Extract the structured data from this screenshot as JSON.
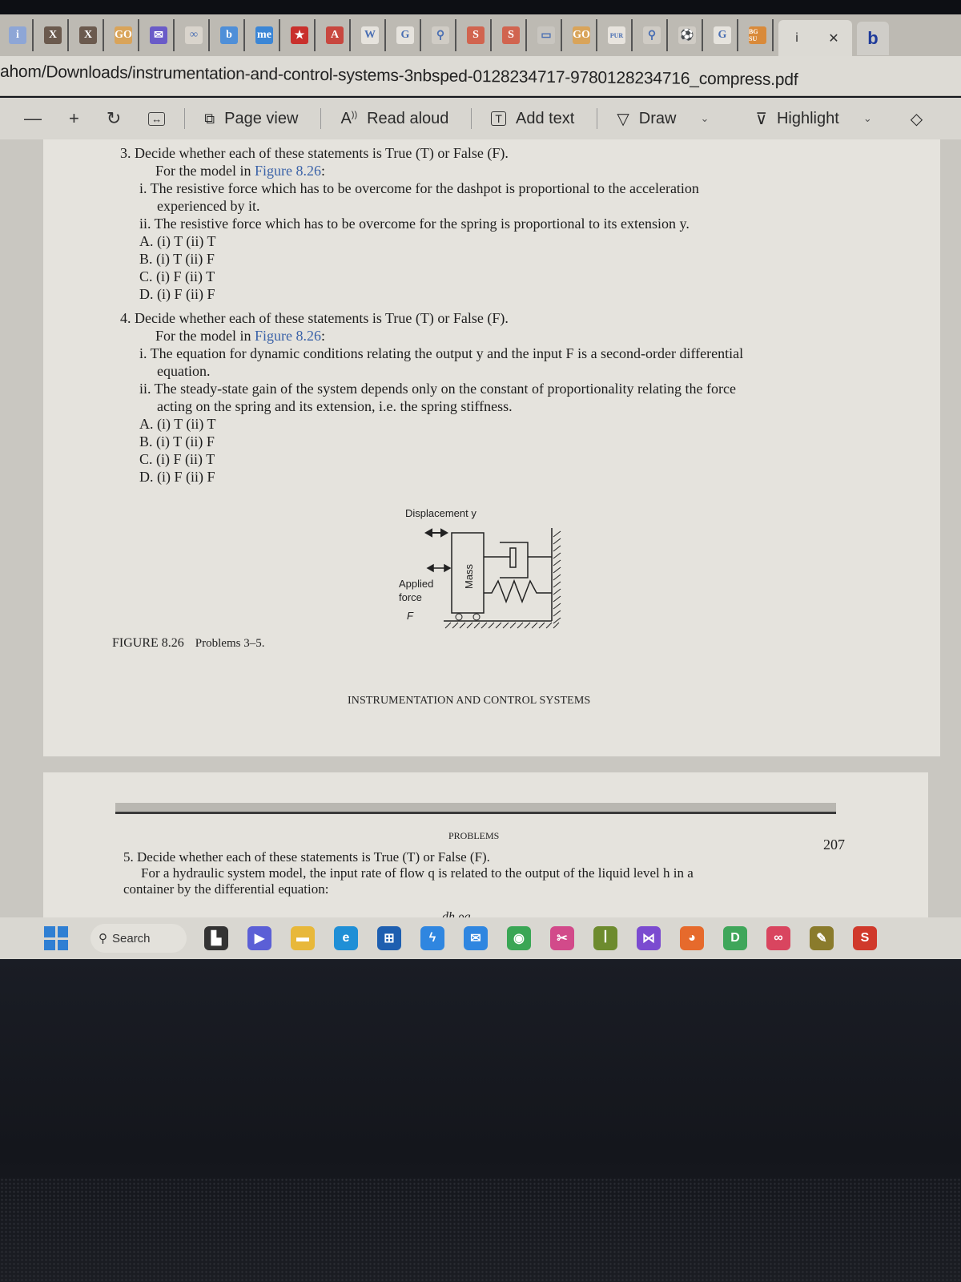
{
  "browser": {
    "tabs": [
      {
        "icon": "info-icon",
        "glyph": "i",
        "color": "#8ea6d6"
      },
      {
        "icon": "x-icon",
        "glyph": "X",
        "color": "#6b5a4e"
      },
      {
        "icon": "x-icon",
        "glyph": "X",
        "color": "#6b5a4e"
      },
      {
        "icon": "go-icon",
        "glyph": "GO",
        "color": "#d9a45a"
      },
      {
        "icon": "mail-icon",
        "glyph": "✉",
        "color": "#6a5bc8"
      },
      {
        "icon": "link-icon",
        "glyph": "∞",
        "color": "#d9d4cc"
      },
      {
        "icon": "bing-icon",
        "glyph": "b",
        "color": "#4f8fd8"
      },
      {
        "icon": "me-icon",
        "glyph": "me",
        "color": "#3b86d6"
      },
      {
        "icon": "star-icon",
        "glyph": "★",
        "color": "#c9302c"
      },
      {
        "icon": "a-icon",
        "glyph": "A",
        "color": "#c8473f"
      },
      {
        "icon": "wikipedia-icon",
        "glyph": "W",
        "color": "#e6e3dd"
      },
      {
        "icon": "google-icon",
        "glyph": "G",
        "color": "#e6e3dd"
      },
      {
        "icon": "search-icon",
        "glyph": "⚲",
        "color": "#d0ccc5"
      },
      {
        "icon": "s-icon",
        "glyph": "S",
        "color": "#d1644f"
      },
      {
        "icon": "s-icon",
        "glyph": "S",
        "color": "#d1644f"
      },
      {
        "icon": "window-icon",
        "glyph": "▭",
        "color": "#c8c5bf"
      },
      {
        "icon": "go-icon",
        "glyph": "GO",
        "color": "#d9a45a"
      },
      {
        "icon": "pur-icon",
        "glyph": "PUR",
        "color": "#e8e4de"
      },
      {
        "icon": "search-icon",
        "glyph": "⚲",
        "color": "#d0ccc5"
      },
      {
        "icon": "soccer-icon",
        "glyph": "⚽",
        "color": "#d0ccc5"
      },
      {
        "icon": "google-icon",
        "glyph": "G",
        "color": "#e6e3dd"
      },
      {
        "icon": "bgsu-icon",
        "glyph": "BG SU",
        "color": "#d98a3a"
      }
    ],
    "active_tab": {
      "label": "i",
      "close_glyph": "✕"
    },
    "extra_tab_glyph": "b",
    "url": "ahom/Downloads/instrumentation-and-control-systems-3nbsped-0128234717-9780128234716_compress.pdf"
  },
  "pdf_toolbar": {
    "zoom_out": "—",
    "zoom_in": "+",
    "rotate_glyph": "↻",
    "fit_glyph": "↔",
    "page_view": "Page view",
    "read_aloud": "Read aloud",
    "add_text": "Add text",
    "draw": "Draw",
    "highlight": "Highlight",
    "chevron": "⌄"
  },
  "document": {
    "q3": {
      "stem": "3. Decide whether each of these statements is True (T) or False (F).",
      "context_prefix": "For the model in ",
      "context_link": "Figure 8.26",
      "context_suffix": ":",
      "s1_a": "i. The resistive force which has to be overcome for the dashpot is proportional to the acceleration",
      "s1_b": "experienced by it.",
      "s2": "ii. The resistive force which has to be overcome for the spring is proportional to its extension y.",
      "options": [
        "A. (i) T (ii) T",
        "B. (i) T (ii) F",
        "C. (i) F (ii) T",
        "D. (i) F (ii) F"
      ]
    },
    "q4": {
      "stem": "4. Decide whether each of these statements is True (T) or False (F).",
      "context_prefix": "For the model in ",
      "context_link": "Figure 8.26",
      "context_suffix": ":",
      "s1_a": "i. The equation for dynamic conditions relating the output y and the input F is a second-order differential",
      "s1_b": "equation.",
      "s2_a": "ii. The steady-state gain of the system depends only on the constant of proportionality relating the force",
      "s2_b": "acting on the spring and its extension, i.e. the spring stiffness.",
      "options": [
        "A. (i) T (ii) T",
        "B. (i) T (ii) F",
        "C. (i) F (ii) T",
        "D. (i) F (ii) F"
      ]
    },
    "figure": {
      "displacement_label": "Displacement y",
      "applied_label_1": "Applied",
      "applied_label_2": "force",
      "force_symbol": "F",
      "mass_label": "Mass"
    },
    "figure_caption_number": "FIGURE 8.26",
    "figure_caption_text": "Problems 3–5.",
    "running_head": "INSTRUMENTATION AND CONTROL SYSTEMS",
    "page2": {
      "section_head": "PROBLEMS",
      "page_number": "207",
      "q5_stem": "5. Decide whether each of these statements is True (T) or False (F).",
      "q5_line1": "For a hydraulic system model, the input rate of flow q is related to the output of the liquid level h in a",
      "q5_line2": "container by the differential equation:",
      "equation_fragment": ". dh     ρg ."
    }
  },
  "taskbar": {
    "search_label": "Search",
    "apps": [
      {
        "name": "task-view-icon",
        "glyph": "▙",
        "color": "#333333"
      },
      {
        "name": "meet-icon",
        "glyph": "▶",
        "color": "#5b5fd6"
      },
      {
        "name": "file-explorer-icon",
        "glyph": "▬",
        "color": "#e8b83a"
      },
      {
        "name": "edge-icon",
        "glyph": "e",
        "color": "#1f8fd6"
      },
      {
        "name": "store-icon",
        "glyph": "⊞",
        "color": "#1e5fb0"
      },
      {
        "name": "power-automate-icon",
        "glyph": "ϟ",
        "color": "#2f86e0"
      },
      {
        "name": "mail-icon",
        "glyph": "✉",
        "color": "#2f86e0"
      },
      {
        "name": "chrome-icon",
        "glyph": "◉",
        "color": "#3aa655"
      },
      {
        "name": "snipping-tool-icon",
        "glyph": "✂",
        "color": "#d24a8a"
      },
      {
        "name": "python-idle-icon",
        "glyph": "ꟾ",
        "color": "#6d8b2e"
      },
      {
        "name": "visual-studio-icon",
        "glyph": "⋈",
        "color": "#7b4bd0"
      },
      {
        "name": "firefox-icon",
        "glyph": "◕",
        "color": "#e66a2c"
      },
      {
        "name": "d-app-icon",
        "glyph": "D",
        "color": "#3fa65a"
      },
      {
        "name": "creative-cloud-icon",
        "glyph": "∞",
        "color": "#d9455f"
      },
      {
        "name": "feather-app-icon",
        "glyph": "✎",
        "color": "#8a7b2c"
      },
      {
        "name": "s-app-icon",
        "glyph": "S",
        "color": "#d0392b"
      }
    ]
  }
}
